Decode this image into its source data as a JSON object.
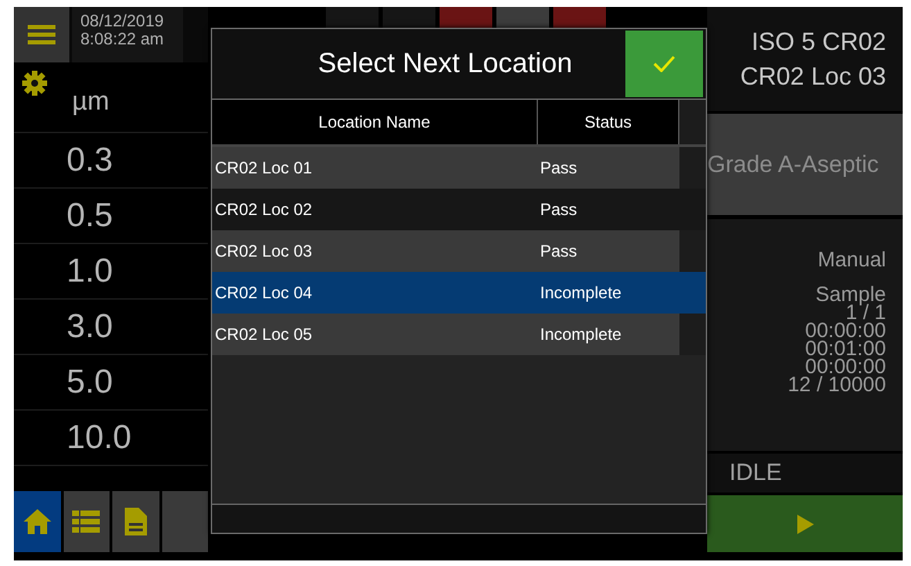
{
  "header": {
    "date": "08/12/2019",
    "time": "8:08:22 am"
  },
  "sizes": {
    "unit": "µm",
    "rows": [
      "0.3",
      "0.5",
      "1.0",
      "3.0",
      "5.0",
      "10.0"
    ]
  },
  "location": {
    "line_1": "ISO 5 CR02",
    "line_2": "CR02 Loc 03"
  },
  "grade": "Grade A-Aseptic",
  "mode": "Manual",
  "sample_info": [
    "Sample",
    "1 / 1",
    "00:00:00",
    "00:01:00",
    "00:00:00",
    "12 / 10000"
  ],
  "status": "IDLE",
  "nav": [
    {
      "kind": "home",
      "selected": true
    },
    {
      "kind": "list",
      "selected": false
    },
    {
      "kind": "document",
      "selected": false
    },
    {
      "kind": "blank",
      "selected": false
    }
  ],
  "dialog": {
    "title": "Select Next Location",
    "columns": [
      "Location Name",
      "Status"
    ],
    "rows": [
      {
        "name": "CR02 Loc 01",
        "status": "Pass",
        "selected": false
      },
      {
        "name": "CR02 Loc 02",
        "status": "Pass",
        "selected": false
      },
      {
        "name": "CR02 Loc 03",
        "status": "Pass",
        "selected": false
      },
      {
        "name": "CR02 Loc 04",
        "status": "Incomplete",
        "selected": true
      },
      {
        "name": "CR02 Loc 05",
        "status": "Incomplete",
        "selected": false
      }
    ]
  }
}
